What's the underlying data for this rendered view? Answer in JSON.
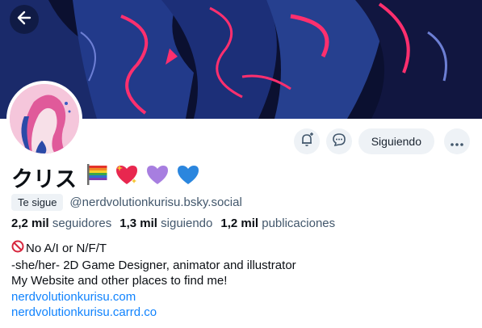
{
  "header": {
    "back_icon": "arrow-left-icon"
  },
  "profile": {
    "display_name": "クリス",
    "emojis": [
      "rainbow-flag",
      "sparkling-heart",
      "purple-heart",
      "blue-heart"
    ],
    "follows_you_badge": "Te sigue",
    "handle": "@nerdvolutionkurisu.bsky.social"
  },
  "actions": {
    "notify_icon": "bell-plus-icon",
    "message_icon": "chat-bubble-icon",
    "follow_label": "Siguiendo",
    "more_icon": "ellipsis-icon"
  },
  "stats": {
    "followers_count": "2,2 mil",
    "followers_label": "seguidores",
    "following_count": "1,3 mil",
    "following_label": "siguiendo",
    "posts_count": "1,2 mil",
    "posts_label": "publicaciones"
  },
  "bio": {
    "line1": "No A/I or N/F/T",
    "line2": "-she/her- 2D Game Designer, animator and illustrator",
    "line3": "My Website and other places to find me!",
    "link1": "nerdvolutionkurisu.com",
    "link2": "nerdvolutionkurisu.carrd.co"
  },
  "colors": {
    "link": "#1083fe",
    "muted_text": "#42576c",
    "button_bg": "#eef2f6",
    "banner_bg": "#0b1030",
    "banner_accent": "#ff2f6e"
  }
}
